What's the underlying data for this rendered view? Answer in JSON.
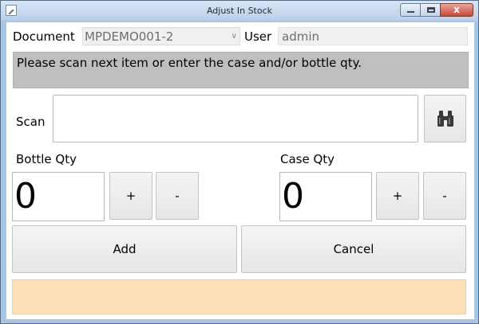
{
  "window": {
    "title": "Adjust In Stock",
    "close_glyph": "x"
  },
  "document": {
    "label": "Document",
    "value": "MPDEMO001-2"
  },
  "user": {
    "label": "User",
    "value": "admin"
  },
  "message": "Please scan next item or enter the case and/or bottle qty.",
  "scan": {
    "label": "Scan",
    "value": ""
  },
  "bottle": {
    "label": "Bottle Qty",
    "value": "0",
    "plus": "+",
    "minus": "-"
  },
  "case": {
    "label": "Case Qty",
    "value": "0",
    "plus": "+",
    "minus": "-"
  },
  "actions": {
    "add": "Add",
    "cancel": "Cancel"
  },
  "colors": {
    "message_bg": "#bfbfbf",
    "footer_bg": "#fbdfb8"
  },
  "icons": {
    "search": "binoculars-icon"
  }
}
